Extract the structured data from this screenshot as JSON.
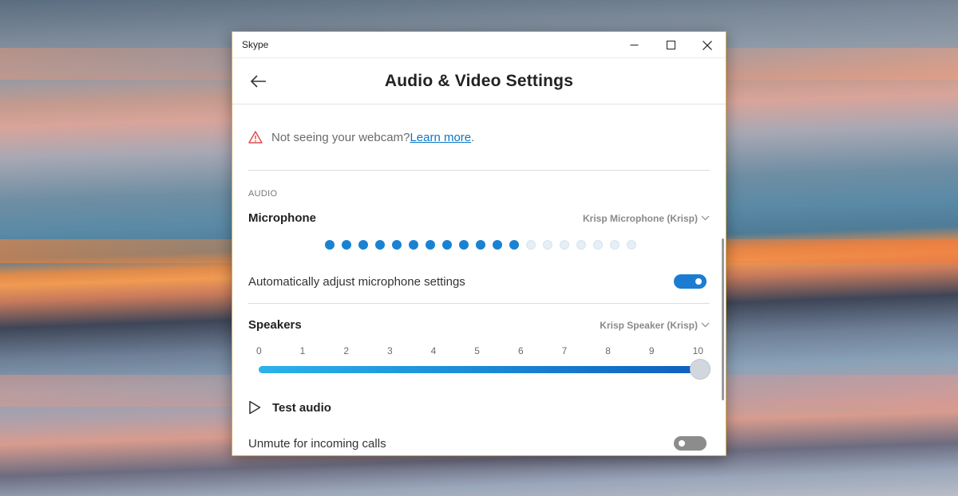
{
  "window": {
    "title": "Skype"
  },
  "header": {
    "title": "Audio & Video Settings"
  },
  "notice": {
    "text": "Not seeing your webcam? ",
    "link": "Learn more",
    "trailing": "."
  },
  "audio": {
    "section_title": "AUDIO",
    "microphone": {
      "label": "Microphone",
      "device": "Krisp Microphone (Krisp)",
      "meter_total": 19,
      "meter_active": 12
    },
    "auto_adjust": {
      "label": "Automatically adjust microphone settings",
      "enabled": true
    },
    "speakers": {
      "label": "Speakers",
      "device": "Krisp Speaker (Krisp)",
      "ticks": [
        "0",
        "1",
        "2",
        "3",
        "4",
        "5",
        "6",
        "7",
        "8",
        "9",
        "10"
      ],
      "volume": 10,
      "max": 10
    },
    "test_audio": {
      "label": "Test audio"
    },
    "unmute_incoming": {
      "label": "Unmute for incoming calls",
      "enabled": false
    }
  },
  "colors": {
    "accent": "#1b7cd2",
    "link": "#0a78c8",
    "warning": "#e04848",
    "window_border": "#c9a657"
  }
}
